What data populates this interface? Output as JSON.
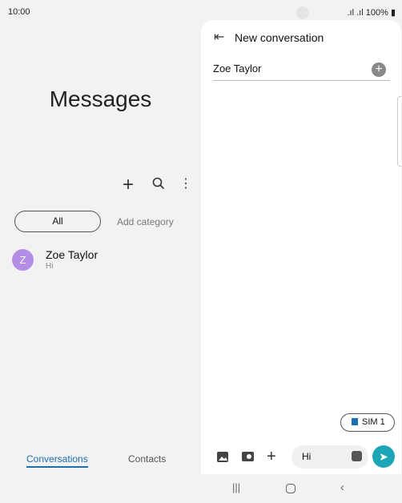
{
  "status": {
    "time": "10:00",
    "battery": "100%"
  },
  "left": {
    "title": "Messages",
    "filters": {
      "all": "All",
      "add_category": "Add category"
    },
    "conversations": [
      {
        "initial": "Z",
        "name": "Zoe Taylor",
        "preview": "Hi",
        "avatar_color": "#b48ee6"
      }
    ],
    "bottom_tabs": [
      {
        "label": "Conversations",
        "active": true
      },
      {
        "label": "Contacts",
        "active": false
      }
    ]
  },
  "right": {
    "title": "New conversation",
    "recipient": "Zoe Taylor",
    "sim": "SIM 1",
    "message": "Hi",
    "accent": "#1ba5b5"
  }
}
